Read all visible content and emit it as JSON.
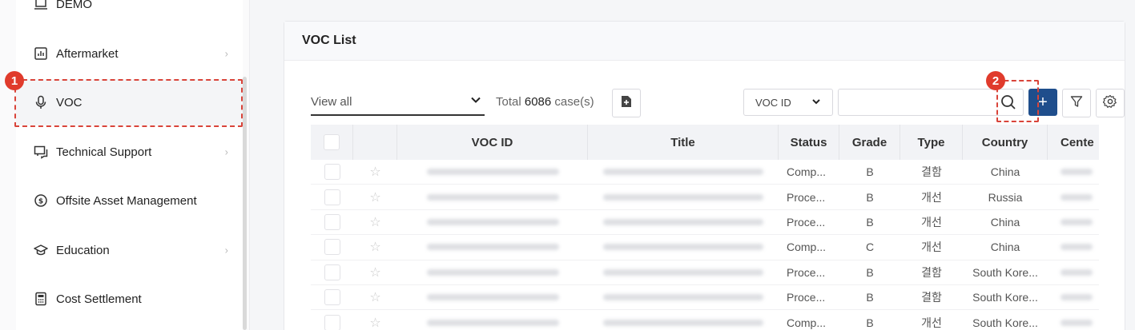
{
  "sidebar": {
    "items": [
      {
        "label": "DEMO",
        "icon": "laptop-icon",
        "has_chevron": false
      },
      {
        "label": "Aftermarket",
        "icon": "bar-chart-icon",
        "has_chevron": true
      },
      {
        "label": "VOC",
        "icon": "microphone-icon",
        "has_chevron": false
      },
      {
        "label": "Technical Support",
        "icon": "chat-icon",
        "has_chevron": true
      },
      {
        "label": "Offsite Asset Management",
        "icon": "dollar-coin-icon",
        "has_chevron": false
      },
      {
        "label": "Education",
        "icon": "graduation-cap-icon",
        "has_chevron": true
      },
      {
        "label": "Cost Settlement",
        "icon": "calculator-icon",
        "has_chevron": false
      }
    ]
  },
  "markers": [
    "1",
    "2"
  ],
  "panel": {
    "title": "VOC List"
  },
  "toolbar": {
    "view_select": "View all",
    "total_prefix": "Total",
    "total_count": "6086",
    "total_suffix": "case(s)",
    "search_field_select": "VOC ID",
    "search_value": "",
    "add_label": "+"
  },
  "table": {
    "headers": [
      "",
      "",
      "VOC ID",
      "Title",
      "Status",
      "Grade",
      "Type",
      "Country",
      "Cente"
    ],
    "rows": [
      {
        "status": "Comp...",
        "grade": "B",
        "type": "결함",
        "country": "China"
      },
      {
        "status": "Proce...",
        "grade": "B",
        "type": "개선",
        "country": "Russia"
      },
      {
        "status": "Proce...",
        "grade": "B",
        "type": "개선",
        "country": "China"
      },
      {
        "status": "Comp...",
        "grade": "C",
        "type": "개선",
        "country": "China"
      },
      {
        "status": "Proce...",
        "grade": "B",
        "type": "결함",
        "country": "South Kore..."
      },
      {
        "status": "Proce...",
        "grade": "B",
        "type": "결함",
        "country": "South Kore..."
      },
      {
        "status": "Comp...",
        "grade": "B",
        "type": "개선",
        "country": "South Kore..."
      }
    ]
  },
  "colors": {
    "accent": "#1f4e8c",
    "highlight": "#e03b2c"
  }
}
